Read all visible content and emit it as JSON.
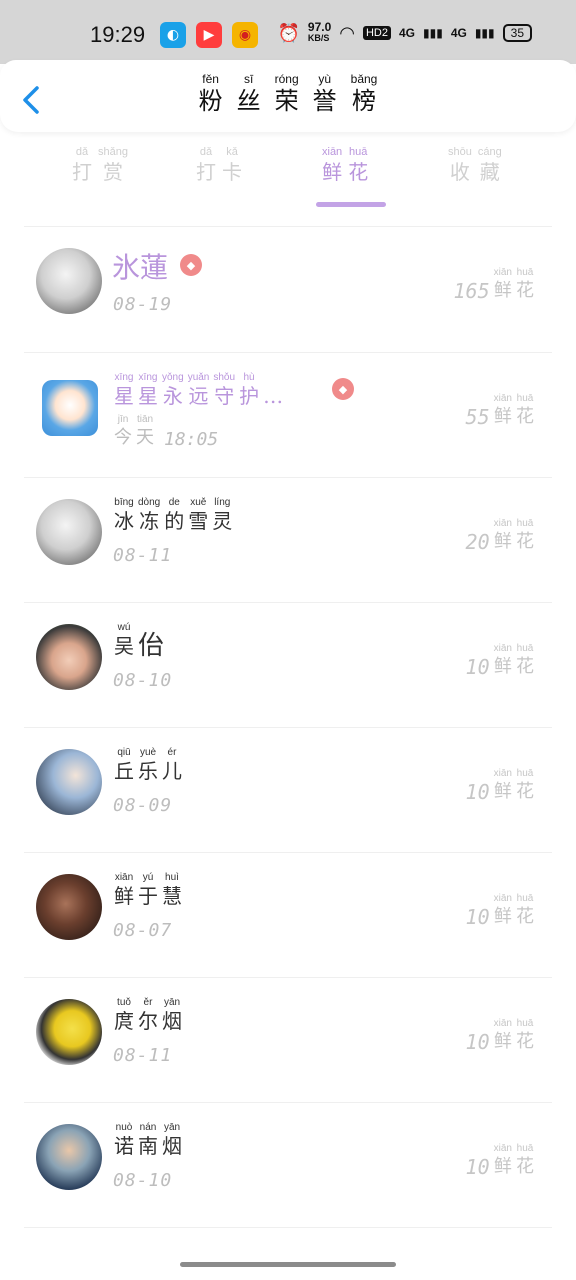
{
  "status_bar": {
    "time": "19:29",
    "speed_value": "97.0",
    "speed_unit": "KB/S",
    "hd": "HD2",
    "signal_1": "4G",
    "signal_2": "4G",
    "battery": "35",
    "app_icons": [
      "qq-icon",
      "video-app-icon",
      "weibo-icon"
    ]
  },
  "header": {
    "back_icon": "chevron-left-icon",
    "title_chars": [
      {
        "py": "fěn",
        "hz": "粉"
      },
      {
        "py": "sī",
        "hz": "丝"
      },
      {
        "py": "róng",
        "hz": "荣"
      },
      {
        "py": "yù",
        "hz": "誉"
      },
      {
        "py": "bǎng",
        "hz": "榜"
      }
    ]
  },
  "tabs": [
    {
      "chars": [
        {
          "py": "dǎ",
          "hz": "打"
        },
        {
          "py": "shǎng",
          "hz": "赏"
        }
      ],
      "active": false
    },
    {
      "chars": [
        {
          "py": "dǎ",
          "hz": "打"
        },
        {
          "py": "kǎ",
          "hz": "卡"
        }
      ],
      "active": false
    },
    {
      "chars": [
        {
          "py": "xiān",
          "hz": "鲜"
        },
        {
          "py": "huā",
          "hz": "花"
        }
      ],
      "active": true
    },
    {
      "chars": [
        {
          "py": "shōu",
          "hz": "收"
        },
        {
          "py": "cáng",
          "hz": "藏"
        }
      ],
      "active": false
    }
  ],
  "unit_chars": [
    {
      "py": "xiān",
      "hz": "鲜"
    },
    {
      "py": "huā",
      "hz": "花"
    }
  ],
  "rows": [
    {
      "name": "氷蓮",
      "name_chars": [],
      "style": "big",
      "badge": true,
      "date": "08-19",
      "count": "165",
      "avatar": "anime-avatar"
    },
    {
      "name": "",
      "name_chars": [
        {
          "py": "xīng",
          "hz": "星"
        },
        {
          "py": "xīng",
          "hz": "星"
        },
        {
          "py": "yǒng",
          "hz": "永"
        },
        {
          "py": "yuǎn",
          "hz": "远"
        },
        {
          "py": "shǒu",
          "hz": "守"
        },
        {
          "py": "hù",
          "hz": "护"
        },
        {
          "py": "",
          "hz": "…"
        }
      ],
      "style": "purple",
      "badge": true,
      "date_chars": [
        {
          "py": "jīn",
          "hz": "今"
        },
        {
          "py": "tiān",
          "hz": "天"
        }
      ],
      "date": "18:05",
      "count": "55",
      "avatar": "cartoon-avatar"
    },
    {
      "name": "",
      "name_chars": [
        {
          "py": "bīng",
          "hz": "冰"
        },
        {
          "py": "dòng",
          "hz": "冻"
        },
        {
          "py": "de",
          "hz": "的"
        },
        {
          "py": "xuě",
          "hz": "雪"
        },
        {
          "py": "líng",
          "hz": "灵"
        }
      ],
      "style": "normal",
      "badge": false,
      "date": "08-11",
      "count": "20",
      "avatar": "anime-avatar"
    },
    {
      "name": "",
      "name_chars": [
        {
          "py": "wú",
          "hz": "吴"
        },
        {
          "py": "",
          "hz": "佁"
        }
      ],
      "style": "normal",
      "badge": false,
      "date": "08-10",
      "count": "10",
      "avatar": "photo-avatar"
    },
    {
      "name": "",
      "name_chars": [
        {
          "py": "qiū",
          "hz": "丘"
        },
        {
          "py": "yuè",
          "hz": "乐"
        },
        {
          "py": "ér",
          "hz": "儿"
        }
      ],
      "style": "normal",
      "badge": false,
      "date": "08-09",
      "count": "10",
      "avatar": "photo-avatar"
    },
    {
      "name": "",
      "name_chars": [
        {
          "py": "xiān",
          "hz": "鲜"
        },
        {
          "py": "yú",
          "hz": "于"
        },
        {
          "py": "huì",
          "hz": "慧"
        }
      ],
      "style": "normal",
      "badge": false,
      "date": "08-07",
      "count": "10",
      "avatar": "photo-avatar"
    },
    {
      "name": "",
      "name_chars": [
        {
          "py": "tuǒ",
          "hz": "庹"
        },
        {
          "py": "ěr",
          "hz": "尔"
        },
        {
          "py": "yān",
          "hz": "烟"
        }
      ],
      "style": "normal",
      "badge": false,
      "date": "08-11",
      "count": "10",
      "avatar": "cartoon-avatar"
    },
    {
      "name": "",
      "name_chars": [
        {
          "py": "nuò",
          "hz": "诺"
        },
        {
          "py": "nán",
          "hz": "南"
        },
        {
          "py": "yān",
          "hz": "烟"
        }
      ],
      "style": "normal",
      "badge": false,
      "date": "08-10",
      "count": "10",
      "avatar": "photo-avatar"
    }
  ],
  "colors": {
    "accent": "#b995dc",
    "badge": "#f08a8a",
    "muted": "#c6c6c6"
  }
}
